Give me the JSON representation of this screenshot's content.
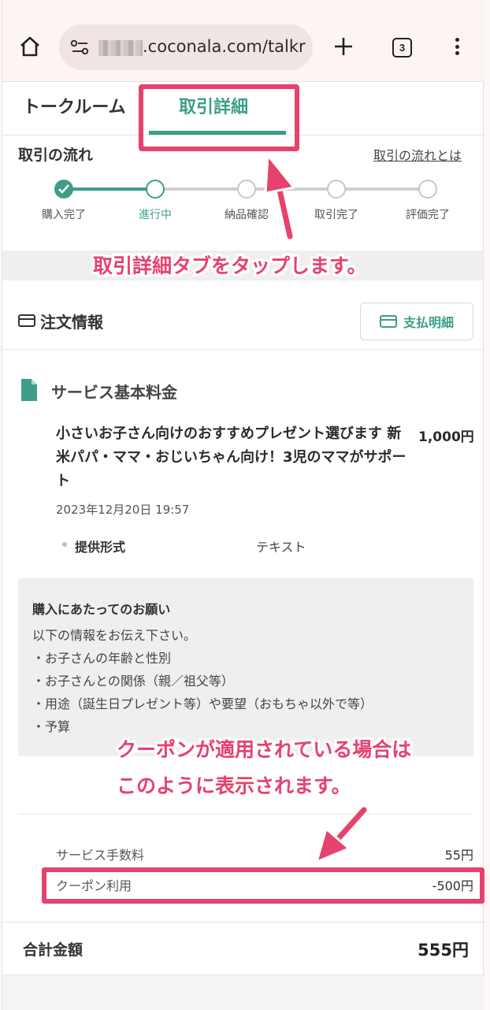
{
  "browser": {
    "url": ".coconala.com/talkr",
    "tab_count": "3"
  },
  "tabs": {
    "talk_room": "トークルーム",
    "transaction_detail": "取引詳細"
  },
  "flow": {
    "title": "取引の流れ",
    "link": "取引の流れとは",
    "steps": [
      {
        "label": "購入完了",
        "state": "done"
      },
      {
        "label": "進行中",
        "state": "current"
      },
      {
        "label": "納品確認",
        "state": "pending"
      },
      {
        "label": "取引完了",
        "state": "pending"
      },
      {
        "label": "評価完了",
        "state": "pending"
      }
    ]
  },
  "order": {
    "title": "注文情報",
    "pay_button": "支払明細"
  },
  "service": {
    "section_title": "サービス基本料金",
    "name": "小さいお子さん向けのおすすめプレゼント選びます 新米パパ・ママ・おじいちゃん向け！3児のママがサポート",
    "price": "1,000円",
    "date": "2023年12月20日 19:57",
    "format_label": "提供形式",
    "format_value": "テキスト"
  },
  "request": {
    "title": "購入にあたってのお願い",
    "lines": [
      "以下の情報をお伝え下さい。",
      "・お子さんの年齢と性別",
      "・お子さんとの関係（親／祖父等）",
      "・用途（誕生日プレゼント等）や要望（おもちゃ以外で等）",
      "・予算"
    ]
  },
  "fees": {
    "service_fee_label": "サービス手数料",
    "service_fee_value": "55円",
    "coupon_label": "クーポン利用",
    "coupon_value": "-500円",
    "total_label": "合計金額",
    "total_value": "555円"
  },
  "annotations": {
    "tap_tab": "取引詳細タブをタップします。",
    "coupon_line1": "クーポンが適用されている場合は",
    "coupon_line2": "このように表示されます。"
  },
  "colors": {
    "accent": "#3e9d88",
    "annotation": "#e6426e"
  }
}
